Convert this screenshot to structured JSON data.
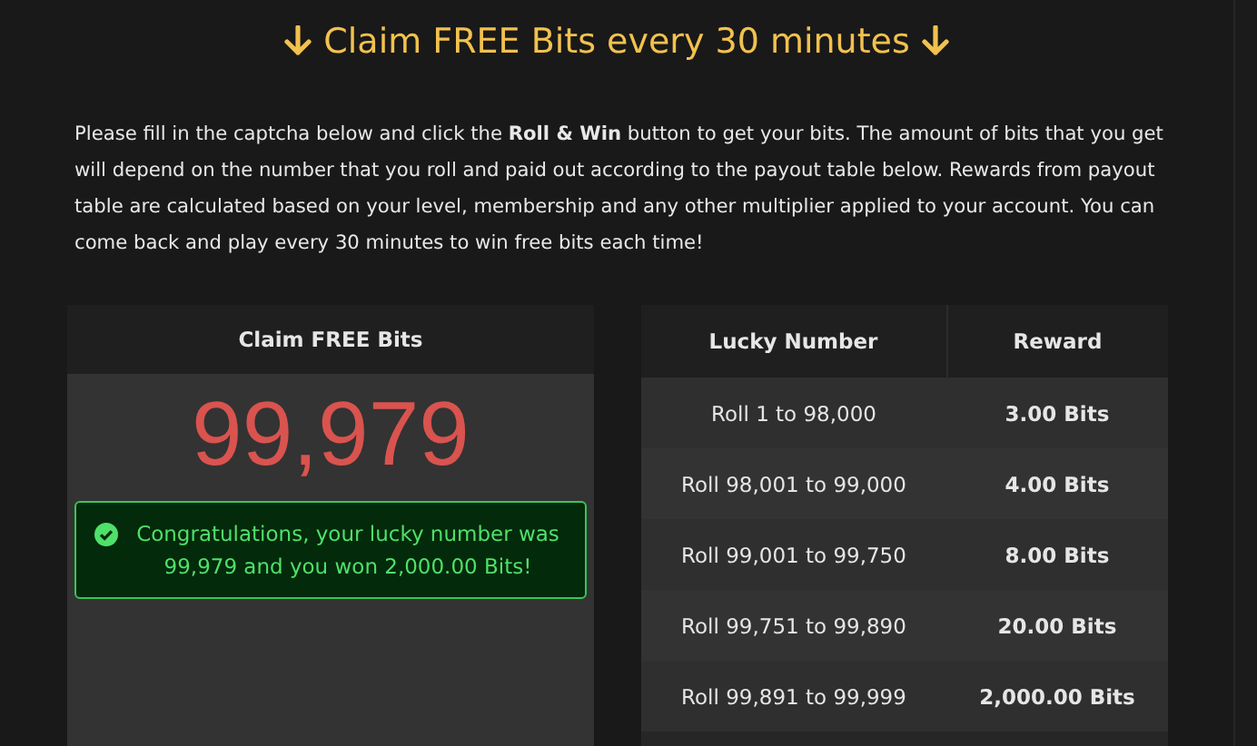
{
  "title": "Claim FREE Bits every 30 minutes",
  "intro": "Please fill in the captcha below and click the **Roll & Win** button to get your bits. The amount of bits that you get will depend on the number that you roll and paid out according to the payout table below. Rewards from payout table are calculated based on your level, membership and any other multiplier applied to your account. You can come back and play every 30 minutes to win free bits each time!",
  "claim_card": {
    "title": "Claim FREE Bits",
    "lucky_number": "99,979",
    "alert": {
      "kind": "success",
      "message": "Congratulations, your lucky number was 99,979 and you won 2,000.00 Bits!"
    }
  },
  "payout_table": {
    "columns": [
      "Lucky Number",
      "Reward"
    ],
    "rows": [
      {
        "range": "Roll 1 to 98,000",
        "reward": "3.00 Bits"
      },
      {
        "range": "Roll 98,001 to 99,000",
        "reward": "4.00 Bits"
      },
      {
        "range": "Roll 99,001 to 99,750",
        "reward": "8.00 Bits"
      },
      {
        "range": "Roll 99,751 to 99,890",
        "reward": "20.00 Bits"
      },
      {
        "range": "Roll 99,891 to 99,999",
        "reward": "2,000.00 Bits"
      }
    ]
  }
}
